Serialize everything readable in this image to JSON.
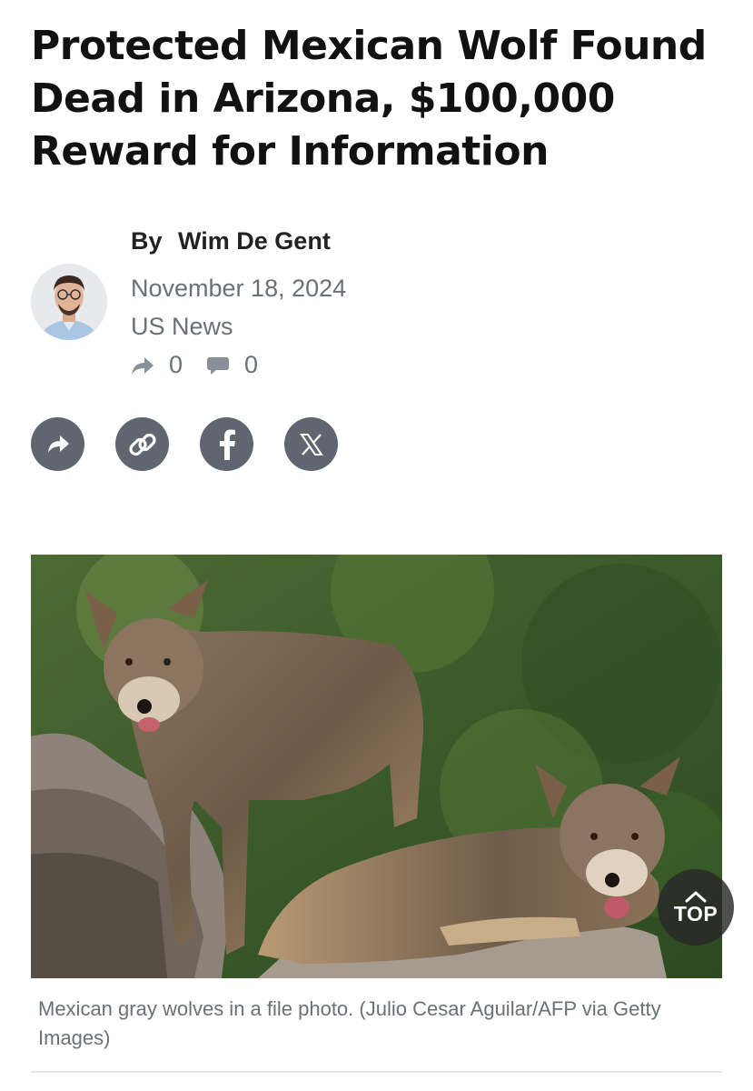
{
  "article": {
    "headline": "Protected Mexican Wolf Found Dead in Arizona, $100,000 Reward for Information",
    "byline_prefix": "By",
    "author": "Wim De Gent",
    "date": "November 18, 2024",
    "category": "US News",
    "share_count": "0",
    "comment_count": "0"
  },
  "share_buttons": [
    {
      "name": "share-button",
      "icon": "share-arrow-icon"
    },
    {
      "name": "copy-link-button",
      "icon": "link-icon"
    },
    {
      "name": "facebook-share-button",
      "icon": "facebook-icon"
    },
    {
      "name": "x-share-button",
      "icon": "x-icon"
    }
  ],
  "photo": {
    "caption": "Mexican gray wolves in a file photo. (Julio Cesar Aguilar/AFP via Getty Images)"
  },
  "top_button": {
    "label": "TOP",
    "icon": "chevron-up-icon"
  },
  "colors": {
    "icon_button": "#5f6670",
    "meta_text": "#6b7077",
    "headline": "#111111"
  }
}
